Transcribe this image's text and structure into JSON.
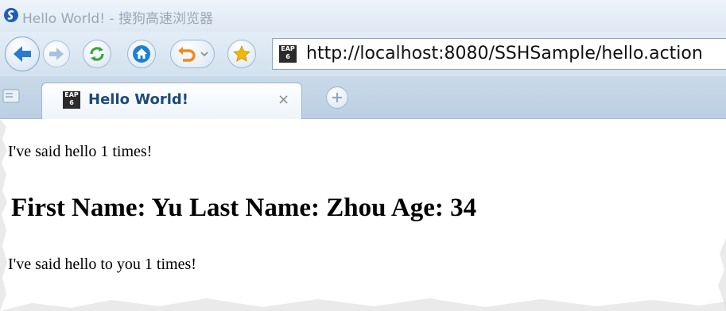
{
  "window": {
    "title": "Hello World! - 搜狗高速浏览器"
  },
  "navbar": {
    "back_icon": "back-arrow-icon",
    "forward_icon": "forward-arrow-icon",
    "refresh_icon": "refresh-icon",
    "home_icon": "home-icon",
    "undo_icon": "undo-icon",
    "favorite_icon": "star-icon",
    "address": "http://localhost:8080/SSHSample/hello.action"
  },
  "tabs": [
    {
      "label": "Hello World!",
      "close": "×"
    }
  ],
  "page": {
    "line1": "I've said hello 1 times!",
    "heading": "First Name: Yu Last Name: Zhou Age: 34",
    "line2": "I've said hello to you 1 times!"
  },
  "colors": {
    "accent": "#2b79d0",
    "refresh_green": "#3aa53a",
    "home_blue": "#1f7fd6",
    "undo_orange": "#f08a1c",
    "star_gold": "#f2b705"
  }
}
